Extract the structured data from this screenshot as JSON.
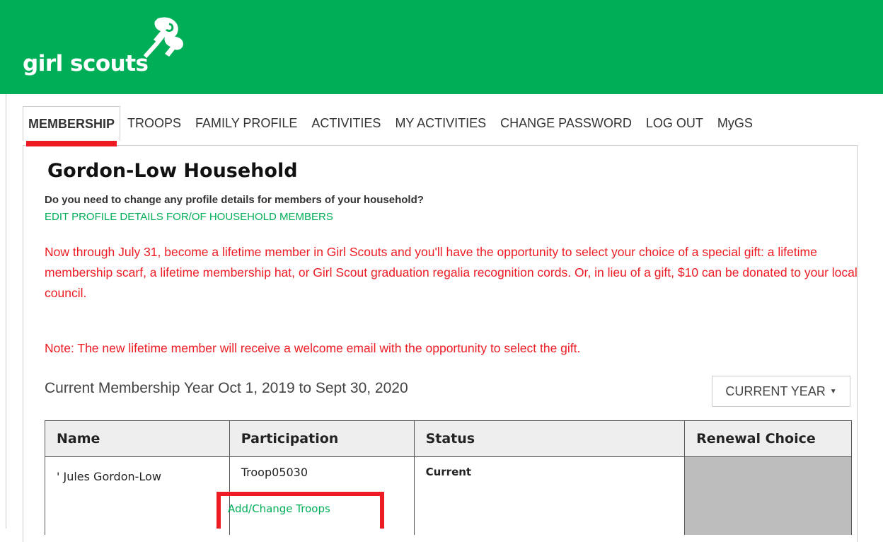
{
  "brand": {
    "logo_text": "girl scouts",
    "primary_color": "#00ae58",
    "accent_color": "#ed1c24"
  },
  "nav": {
    "items": [
      {
        "label": "MEMBERSHIP",
        "active": true
      },
      {
        "label": "TROOPS",
        "active": false
      },
      {
        "label": "FAMILY PROFILE",
        "active": false
      },
      {
        "label": "ACTIVITIES",
        "active": false
      },
      {
        "label": "MY ACTIVITIES",
        "active": false
      },
      {
        "label": "CHANGE PASSWORD",
        "active": false
      },
      {
        "label": "LOG OUT",
        "active": false
      },
      {
        "label": "MyGS",
        "active": false
      }
    ]
  },
  "household": {
    "title": "Gordon-Low Household",
    "question": "Do you need to change any profile details for members of your household?",
    "edit_link": "EDIT PROFILE DETAILS FOR/OF HOUSEHOLD MEMBERS"
  },
  "promo": {
    "text": "Now through July 31, become a lifetime member in Girl Scouts and you'll have the opportunity to select your choice of a special gift: a lifetime membership scarf, a lifetime membership hat, or Girl Scout graduation regalia recognition cords. Or, in lieu of a gift, $10 can be donated to your local council.",
    "note": "Note: The new lifetime member will receive a welcome email with the opportunity to select the gift."
  },
  "membership_year": {
    "label": "Current Membership Year Oct 1, 2019 to Sept 30, 2020",
    "selector_value": "CURRENT YEAR",
    "selector_icon": "caret-down-icon"
  },
  "table": {
    "headers": [
      "Name",
      "Participation",
      "Status",
      "Renewal Choice"
    ],
    "rows": [
      {
        "name": "' Jules Gordon-Low",
        "participation": "Troop05030",
        "participation_link": "Add/Change Troops",
        "status": "Current",
        "renewal_choice": ""
      }
    ]
  }
}
